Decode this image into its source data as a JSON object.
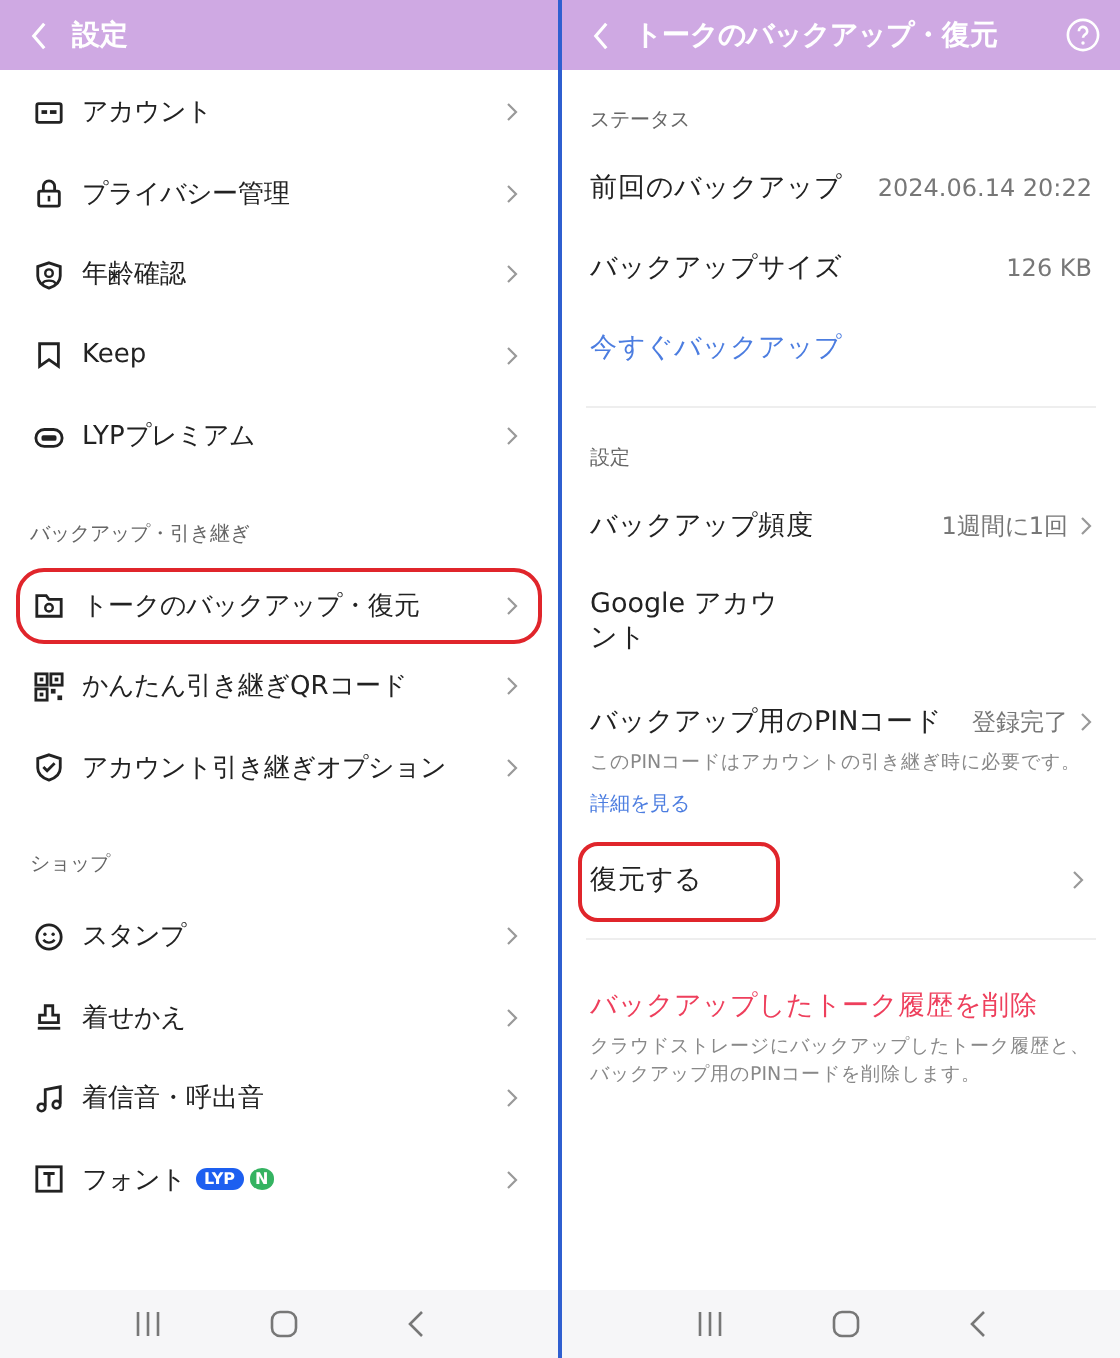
{
  "left": {
    "header": {
      "title": "設定"
    },
    "sections": [
      {
        "items": [
          {
            "label": "アカウント",
            "kind": "card",
            "highlighted": false
          },
          {
            "label": "プライバシー管理",
            "kind": "lock",
            "highlighted": false
          },
          {
            "label": "年齢確認",
            "kind": "shield-person",
            "highlighted": false
          },
          {
            "label": "Keep",
            "kind": "bookmark",
            "highlighted": false
          },
          {
            "label": "LYPプレミアム",
            "kind": "lyp",
            "highlighted": false
          }
        ]
      },
      {
        "title": "バックアップ・引き継ぎ",
        "items": [
          {
            "label": "トークのバックアップ・復元",
            "kind": "folder",
            "highlighted": true
          },
          {
            "label": "かんたん引き継ぎQRコード",
            "kind": "qr",
            "highlighted": false
          },
          {
            "label": "アカウント引き継ぎオプション",
            "kind": "shield-check",
            "highlighted": false
          }
        ]
      },
      {
        "title": "ショップ",
        "items": [
          {
            "label": "スタンプ",
            "kind": "smile",
            "highlighted": false
          },
          {
            "label": "着せかえ",
            "kind": "stamp",
            "highlighted": false
          },
          {
            "label": "着信音・呼出音",
            "kind": "music",
            "highlighted": false
          },
          {
            "label": "フォント",
            "kind": "text",
            "highlighted": false,
            "badges": [
              {
                "text": "LYP",
                "kind": "lyp"
              },
              {
                "text": "N",
                "kind": "new"
              }
            ]
          }
        ]
      }
    ]
  },
  "right": {
    "header": {
      "title": "トークのバックアップ・復元"
    },
    "sections": [
      {
        "title": "ステータス",
        "rows": [
          {
            "kind": "info",
            "label": "前回のバックアップ",
            "value": "2024.06.14 20:22",
            "highlighted": false
          },
          {
            "kind": "info",
            "label": "バックアップサイズ",
            "value": "126 KB",
            "highlighted": false
          },
          {
            "kind": "link",
            "label": "今すぐバックアップ",
            "highlighted": false
          }
        ]
      },
      {
        "title": "設定",
        "rows": [
          {
            "kind": "nav",
            "label": "バックアップ頻度",
            "value": "1週間に1回",
            "highlighted": false
          },
          {
            "kind": "plain",
            "label": "Google アカウント",
            "highlighted": false
          },
          {
            "kind": "nav",
            "label": "バックアップ用のPINコード",
            "value": "登録完了",
            "note": "このPINコードはアカウントの引き継ぎ時に必要です。",
            "link": "詳細を見る",
            "highlighted": false
          },
          {
            "kind": "nav",
            "label": "復元する",
            "highlighted": true
          }
        ]
      },
      {
        "rows": [
          {
            "kind": "danger",
            "label": "バックアップしたトーク履歴を削除",
            "note": "クラウドストレージにバックアップしたトーク履歴と、バックアップ用のPINコードを削除します。",
            "highlighted": false
          }
        ]
      }
    ]
  }
}
